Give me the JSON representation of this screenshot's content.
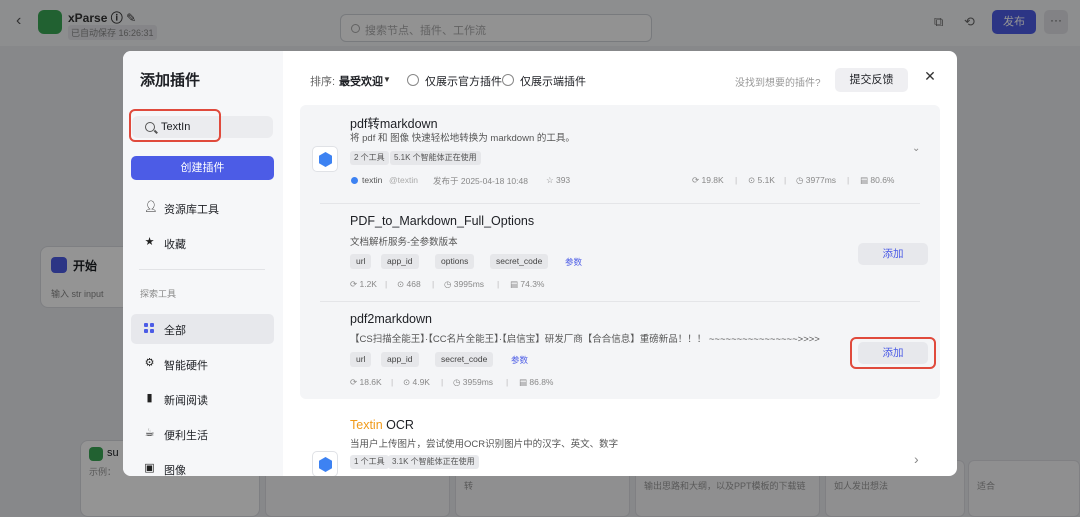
{
  "app": {
    "title": "xParse",
    "saved": "已自动保存 16:26:31",
    "search_placeholder": "搜索节点、插件、工作流",
    "publish": "发布",
    "more": "···",
    "back": "‹",
    "edit_icon": "✎",
    "info_icon": "ⓘ",
    "node_start": {
      "title": "开始",
      "sub": "输入  str input"
    },
    "node_sum": {
      "title": "su",
      "sub": "示例："
    },
    "bg_cards": [
      "转",
      "输出思路和大纲，以及PPT模板的下载链",
      "如人发出想法",
      "适合"
    ]
  },
  "modal": {
    "title": "添加插件",
    "search_value": "TextIn",
    "create_button": "创建插件",
    "sidebar": {
      "library": "资源库工具",
      "favorites": "收藏",
      "section": "探索工具",
      "categories": [
        "全部",
        "智能硬件",
        "新闻阅读",
        "便利生活",
        "图像"
      ]
    },
    "filter": {
      "sort_label": "排序:",
      "sort_value": "最受欢迎",
      "caret": "▼",
      "official_only": "仅展示官方插件",
      "client_only": "仅展示端插件",
      "not_found": "没找到想要的插件?",
      "feedback": "提交反馈",
      "close": "✕"
    },
    "plugins": [
      {
        "name": "pdf转markdown",
        "desc": "将 pdf 和 图像 快速轻松地转换为 markdown 的工具。",
        "tags": [
          "2 个工具",
          "5.1K 个智能体正在使用"
        ],
        "author": "textin",
        "author_handle": "@textin",
        "published": "发布于  2025-04-18 10:48",
        "stars": "☆ 393",
        "stats": [
          "⟳ 19.8K",
          "⊙ 5.1K",
          "◷ 3977ms",
          "▤ 80.6%"
        ],
        "chevron": "⌄"
      },
      {
        "name": "PDF_to_Markdown_Full_Options",
        "desc": "文档解析服务-全参数版本",
        "params": [
          "url",
          "app_id",
          "options",
          "secret_code"
        ],
        "params_link": "参数",
        "stats": [
          "⟳ 1.2K",
          "⊙ 468",
          "◷ 3995ms",
          "▤ 74.3%"
        ],
        "add": "添加"
      },
      {
        "name": "pdf2markdown",
        "desc": "【CS扫描全能王】·【CC名片全能王】·【启信宝】研发厂商【合合信息】重磅新品！！！ ~~~~~~~~~~~~~~~~>>>>文档解...",
        "params": [
          "url",
          "app_id",
          "secret_code"
        ],
        "params_link": "参数",
        "stats": [
          "⟳ 18.6K",
          "⊙ 4.9K",
          "◷ 3959ms",
          "▤ 86.8%"
        ],
        "add": "添加"
      },
      {
        "name_highlight": "Textin",
        "name_rest": " OCR",
        "desc": "当用户上传图片，尝试使用OCR识别图片中的汉字、英文、数字",
        "tags": [
          "1 个工具",
          "3.1K 个智能体正在使用"
        ],
        "chevron": "›"
      }
    ]
  },
  "colors": {
    "accent": "#4c5ce6",
    "highlight": "#e04a3c",
    "brand_orange": "#f09a1a"
  }
}
